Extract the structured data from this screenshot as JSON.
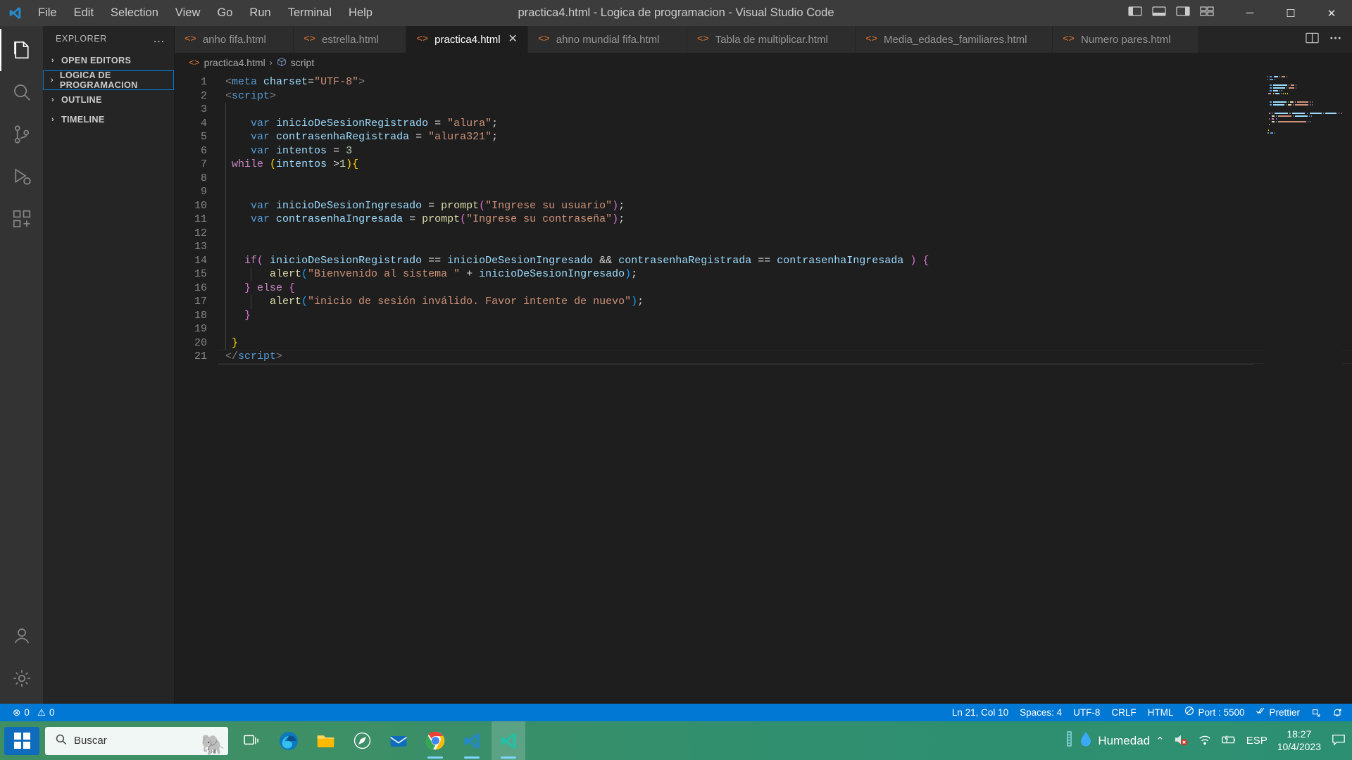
{
  "titlebar": {
    "menu": [
      "File",
      "Edit",
      "Selection",
      "View",
      "Go",
      "Run",
      "Terminal",
      "Help"
    ],
    "window_title": "practica4.html - Logica de programacion - Visual Studio Code",
    "minimize": "─",
    "maximize": "☐",
    "close": "✕"
  },
  "activitybar": {
    "items": [
      {
        "name": "explorer-icon",
        "label": "Explorer"
      },
      {
        "name": "search-icon",
        "label": "Search"
      },
      {
        "name": "source-control-icon",
        "label": "Source Control"
      },
      {
        "name": "run-debug-icon",
        "label": "Run and Debug"
      },
      {
        "name": "extensions-icon",
        "label": "Extensions"
      }
    ],
    "bottom": [
      {
        "name": "accounts-icon",
        "label": "Accounts"
      },
      {
        "name": "settings-gear-icon",
        "label": "Manage"
      }
    ]
  },
  "sidebar": {
    "title": "EXPLORER",
    "more_actions": "…",
    "sections": [
      {
        "label": "OPEN EDITORS",
        "expanded": false,
        "focused": false
      },
      {
        "label": "LOGICA DE PROGRAMACION",
        "expanded": false,
        "focused": true
      },
      {
        "label": "OUTLINE",
        "expanded": false,
        "focused": false
      },
      {
        "label": "TIMELINE",
        "expanded": false,
        "focused": false
      }
    ],
    "chevron": "›"
  },
  "tabs": [
    {
      "label": "anho fifa.html",
      "active": false
    },
    {
      "label": "estrella.html",
      "active": false
    },
    {
      "label": "practica4.html",
      "active": true
    },
    {
      "label": "ahno mundial fifa.html",
      "active": false
    },
    {
      "label": "Tabla de multiplicar.html",
      "active": false
    },
    {
      "label": "Media_edades_familiares.html",
      "active": false
    },
    {
      "label": "Numero pares.html",
      "active": false
    }
  ],
  "tab_close_glyph": "✕",
  "tabbar_actions": [
    {
      "name": "split-editor-icon"
    },
    {
      "name": "more-actions-icon"
    }
  ],
  "breadcrumb": {
    "file": "practica4.html",
    "separator": "›",
    "symbol": "script"
  },
  "editor": {
    "line_numbers": [
      1,
      2,
      3,
      4,
      5,
      6,
      7,
      8,
      9,
      10,
      11,
      12,
      13,
      14,
      15,
      16,
      17,
      18,
      19,
      20,
      21
    ],
    "cursor_line": 21,
    "code_lines": [
      {
        "n": 1,
        "tokens": [
          {
            "t": "brk",
            "v": "<"
          },
          {
            "t": "tag",
            "v": "meta"
          },
          {
            "t": "plain",
            "v": " "
          },
          {
            "t": "attr",
            "v": "charset"
          },
          {
            "t": "op",
            "v": "="
          },
          {
            "t": "str",
            "v": "\"UTF-8\""
          },
          {
            "t": "brk",
            "v": ">"
          }
        ]
      },
      {
        "n": 2,
        "tokens": [
          {
            "t": "brk",
            "v": "<"
          },
          {
            "t": "tag",
            "v": "script"
          },
          {
            "t": "brk",
            "v": ">"
          }
        ]
      },
      {
        "n": 3,
        "tokens": []
      },
      {
        "n": 4,
        "tokens": [
          {
            "t": "plain",
            "v": "    "
          },
          {
            "t": "kw",
            "v": "var"
          },
          {
            "t": "plain",
            "v": " "
          },
          {
            "t": "var",
            "v": "inicioDeSesionRegistrado"
          },
          {
            "t": "op",
            "v": " = "
          },
          {
            "t": "str",
            "v": "\"alura\""
          },
          {
            "t": "plain",
            "v": ";"
          }
        ]
      },
      {
        "n": 5,
        "tokens": [
          {
            "t": "plain",
            "v": "    "
          },
          {
            "t": "kw",
            "v": "var"
          },
          {
            "t": "plain",
            "v": " "
          },
          {
            "t": "var",
            "v": "contrasenhaRegistrada"
          },
          {
            "t": "op",
            "v": " = "
          },
          {
            "t": "str",
            "v": "\"alura321\""
          },
          {
            "t": "plain",
            "v": ";"
          }
        ]
      },
      {
        "n": 6,
        "tokens": [
          {
            "t": "plain",
            "v": "    "
          },
          {
            "t": "kw",
            "v": "var"
          },
          {
            "t": "plain",
            "v": " "
          },
          {
            "t": "var",
            "v": "intentos"
          },
          {
            "t": "op",
            "v": " = "
          },
          {
            "t": "num",
            "v": "3"
          }
        ]
      },
      {
        "n": 7,
        "tokens": [
          {
            "t": "plain",
            "v": " "
          },
          {
            "t": "kwctl",
            "v": "while"
          },
          {
            "t": "plain",
            "v": " "
          },
          {
            "t": "p1",
            "v": "("
          },
          {
            "t": "var",
            "v": "intentos"
          },
          {
            "t": "op",
            "v": " >"
          },
          {
            "t": "num",
            "v": "1"
          },
          {
            "t": "p1",
            "v": ")"
          },
          {
            "t": "p1",
            "v": "{"
          }
        ]
      },
      {
        "n": 8,
        "tokens": []
      },
      {
        "n": 9,
        "tokens": []
      },
      {
        "n": 10,
        "tokens": [
          {
            "t": "plain",
            "v": "    "
          },
          {
            "t": "kw",
            "v": "var"
          },
          {
            "t": "plain",
            "v": " "
          },
          {
            "t": "var",
            "v": "inicioDeSesionIngresado"
          },
          {
            "t": "op",
            "v": " = "
          },
          {
            "t": "fn",
            "v": "prompt"
          },
          {
            "t": "p2",
            "v": "("
          },
          {
            "t": "str",
            "v": "\"Ingrese su usuario\""
          },
          {
            "t": "p2",
            "v": ")"
          },
          {
            "t": "plain",
            "v": ";"
          }
        ]
      },
      {
        "n": 11,
        "tokens": [
          {
            "t": "plain",
            "v": "    "
          },
          {
            "t": "kw",
            "v": "var"
          },
          {
            "t": "plain",
            "v": " "
          },
          {
            "t": "var",
            "v": "contrasenhaIngresada"
          },
          {
            "t": "op",
            "v": " = "
          },
          {
            "t": "fn",
            "v": "prompt"
          },
          {
            "t": "p2",
            "v": "("
          },
          {
            "t": "str",
            "v": "\"Ingrese su contraseña\""
          },
          {
            "t": "p2",
            "v": ")"
          },
          {
            "t": "plain",
            "v": ";"
          }
        ]
      },
      {
        "n": 12,
        "tokens": []
      },
      {
        "n": 13,
        "tokens": []
      },
      {
        "n": 14,
        "tokens": [
          {
            "t": "plain",
            "v": "   "
          },
          {
            "t": "kwctl",
            "v": "if"
          },
          {
            "t": "p2",
            "v": "("
          },
          {
            "t": "plain",
            "v": " "
          },
          {
            "t": "var",
            "v": "inicioDeSesionRegistrado"
          },
          {
            "t": "op",
            "v": " == "
          },
          {
            "t": "var",
            "v": "inicioDeSesionIngresado"
          },
          {
            "t": "plain",
            "v": " "
          },
          {
            "t": "op",
            "v": "&&"
          },
          {
            "t": "plain",
            "v": " "
          },
          {
            "t": "var",
            "v": "contrasenhaRegistrada"
          },
          {
            "t": "op",
            "v": " == "
          },
          {
            "t": "var",
            "v": "contrasenhaIngresada"
          },
          {
            "t": "plain",
            "v": " "
          },
          {
            "t": "p2",
            "v": ")"
          },
          {
            "t": "plain",
            "v": " "
          },
          {
            "t": "p2",
            "v": "{"
          }
        ]
      },
      {
        "n": 15,
        "tokens": [
          {
            "t": "plain",
            "v": "       "
          },
          {
            "t": "fn",
            "v": "alert"
          },
          {
            "t": "p3",
            "v": "("
          },
          {
            "t": "str",
            "v": "\"Bienvenido al sistema \""
          },
          {
            "t": "op",
            "v": " + "
          },
          {
            "t": "var",
            "v": "inicioDeSesionIngresado"
          },
          {
            "t": "p3",
            "v": ")"
          },
          {
            "t": "plain",
            "v": ";"
          }
        ]
      },
      {
        "n": 16,
        "tokens": [
          {
            "t": "plain",
            "v": "   "
          },
          {
            "t": "p2",
            "v": "}"
          },
          {
            "t": "plain",
            "v": " "
          },
          {
            "t": "kwctl",
            "v": "else"
          },
          {
            "t": "plain",
            "v": " "
          },
          {
            "t": "p2",
            "v": "{"
          }
        ]
      },
      {
        "n": 17,
        "tokens": [
          {
            "t": "plain",
            "v": "       "
          },
          {
            "t": "fn",
            "v": "alert"
          },
          {
            "t": "p3",
            "v": "("
          },
          {
            "t": "str",
            "v": "\"inicio de sesión inválido. Favor intente de nuevo\""
          },
          {
            "t": "p3",
            "v": ")"
          },
          {
            "t": "plain",
            "v": ";"
          }
        ]
      },
      {
        "n": 18,
        "tokens": [
          {
            "t": "plain",
            "v": "   "
          },
          {
            "t": "p2",
            "v": "}"
          }
        ]
      },
      {
        "n": 19,
        "tokens": []
      },
      {
        "n": 20,
        "tokens": [
          {
            "t": "plain",
            "v": " "
          },
          {
            "t": "p1",
            "v": "}"
          }
        ]
      },
      {
        "n": 21,
        "tokens": [
          {
            "t": "brk",
            "v": "</"
          },
          {
            "t": "tag",
            "v": "script"
          },
          {
            "t": "brk",
            "v": ">"
          }
        ]
      }
    ]
  },
  "statusbar": {
    "errors": "0",
    "warnings": "0",
    "error_icon": "⊗",
    "warning_icon": "⚠",
    "items": [
      {
        "name": "cursor-position",
        "label": "Ln 21, Col 10"
      },
      {
        "name": "indentation",
        "label": "Spaces: 4"
      },
      {
        "name": "encoding",
        "label": "UTF-8"
      },
      {
        "name": "eol",
        "label": "CRLF"
      },
      {
        "name": "language-mode",
        "label": "HTML"
      },
      {
        "name": "live-server-port",
        "label": "Port : 5500"
      },
      {
        "name": "prettier",
        "label": "Prettier"
      }
    ],
    "right_icons": [
      {
        "name": "remote-window-icon"
      },
      {
        "name": "notifications-bell-icon"
      }
    ]
  },
  "taskbar": {
    "search_placeholder": "Buscar",
    "apps": [
      {
        "name": "task-view-icon",
        "label": "Task View"
      },
      {
        "name": "microsoft-edge-icon",
        "label": "Microsoft Edge"
      },
      {
        "name": "file-explorer-icon",
        "label": "File Explorer"
      },
      {
        "name": "compass-icon",
        "label": "Compass"
      },
      {
        "name": "mail-icon",
        "label": "Mail"
      },
      {
        "name": "chrome-icon",
        "label": "Google Chrome"
      },
      {
        "name": "vscode-icon",
        "label": "Visual Studio Code"
      },
      {
        "name": "vscode-insiders-icon",
        "label": "Visual Studio Code Insiders"
      }
    ],
    "weather_label": "Humedad",
    "language": "ESP",
    "time": "18:27",
    "date": "10/4/2023",
    "tray_expand": "⌃"
  },
  "colors": {
    "accent": "#0078d4",
    "editor_bg": "#1e1e1e",
    "sidebar_bg": "#252526",
    "activitybar_bg": "#333333",
    "titlebar_bg": "#3c3c3c",
    "tab_active_bg": "#1e1e1e",
    "tab_icon": "#e37933",
    "taskbar_green": "#2f8f6f"
  }
}
